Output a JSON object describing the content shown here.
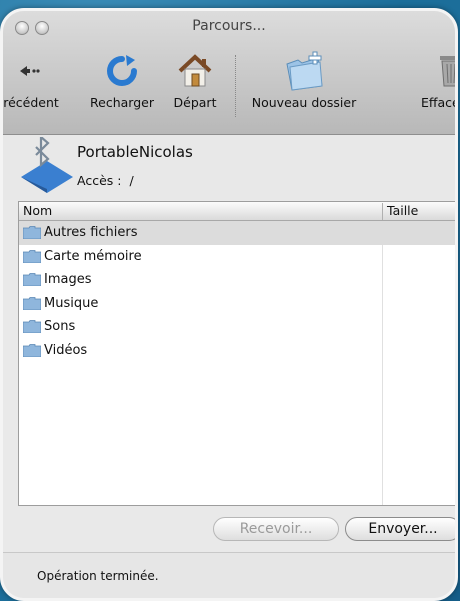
{
  "window": {
    "title": "Parcours..."
  },
  "toolbar": {
    "items": [
      {
        "label": "récédent",
        "icon": "back-arrow-icon"
      },
      {
        "label": "Recharger",
        "icon": "reload-icon"
      },
      {
        "label": "Départ",
        "icon": "home-icon"
      },
      {
        "label": "Nouveau dossier",
        "icon": "new-folder-icon"
      },
      {
        "label": "Efface",
        "icon": "trash-icon"
      }
    ]
  },
  "device": {
    "name": "PortableNicolas",
    "access_label": "Accès :",
    "path": "/",
    "icon": "bluetooth-icon"
  },
  "file_list": {
    "columns": [
      "Nom",
      "Taille"
    ],
    "items": [
      {
        "name": "Autres fichiers",
        "selected": true
      },
      {
        "name": "Carte mémoire"
      },
      {
        "name": "Images"
      },
      {
        "name": "Musique"
      },
      {
        "name": "Sons"
      },
      {
        "name": "Vidéos"
      }
    ]
  },
  "buttons": {
    "receive": "Recevoir...",
    "send": "Envoyer..."
  },
  "status": {
    "text": "Opération terminée."
  },
  "colors": {
    "folder": "#8fb6dc",
    "selection": "#dcdcdc",
    "accent": "#2a7ad0"
  }
}
